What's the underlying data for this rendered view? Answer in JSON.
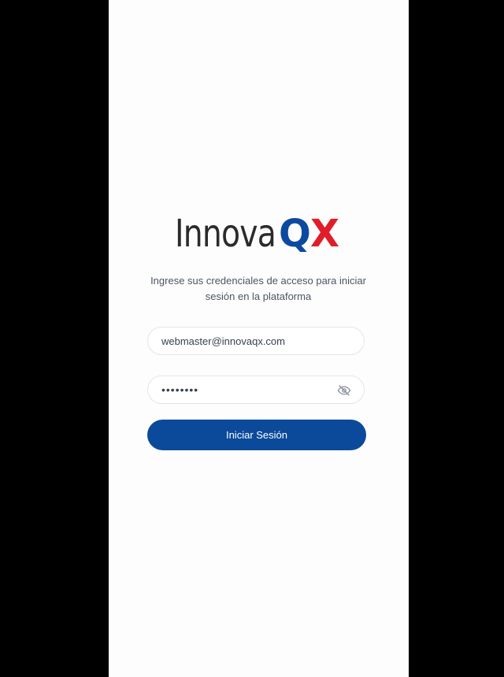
{
  "brand": {
    "logo_part1": "Innova",
    "logo_q": "Q",
    "logo_x": "X",
    "color_dark": "#2b2b2b",
    "color_blue": "#0c4aa0",
    "color_red": "#e11d2a"
  },
  "login": {
    "instructions": "Ingrese sus credenciales de acceso para iniciar sesión en la plataforma",
    "email_value": "webmaster@innovaqx.com",
    "password_value": "password",
    "password_toggle_icon": "eye-off-icon",
    "submit_label": "Iniciar Sesión",
    "accent_color": "#0b4a9a"
  }
}
